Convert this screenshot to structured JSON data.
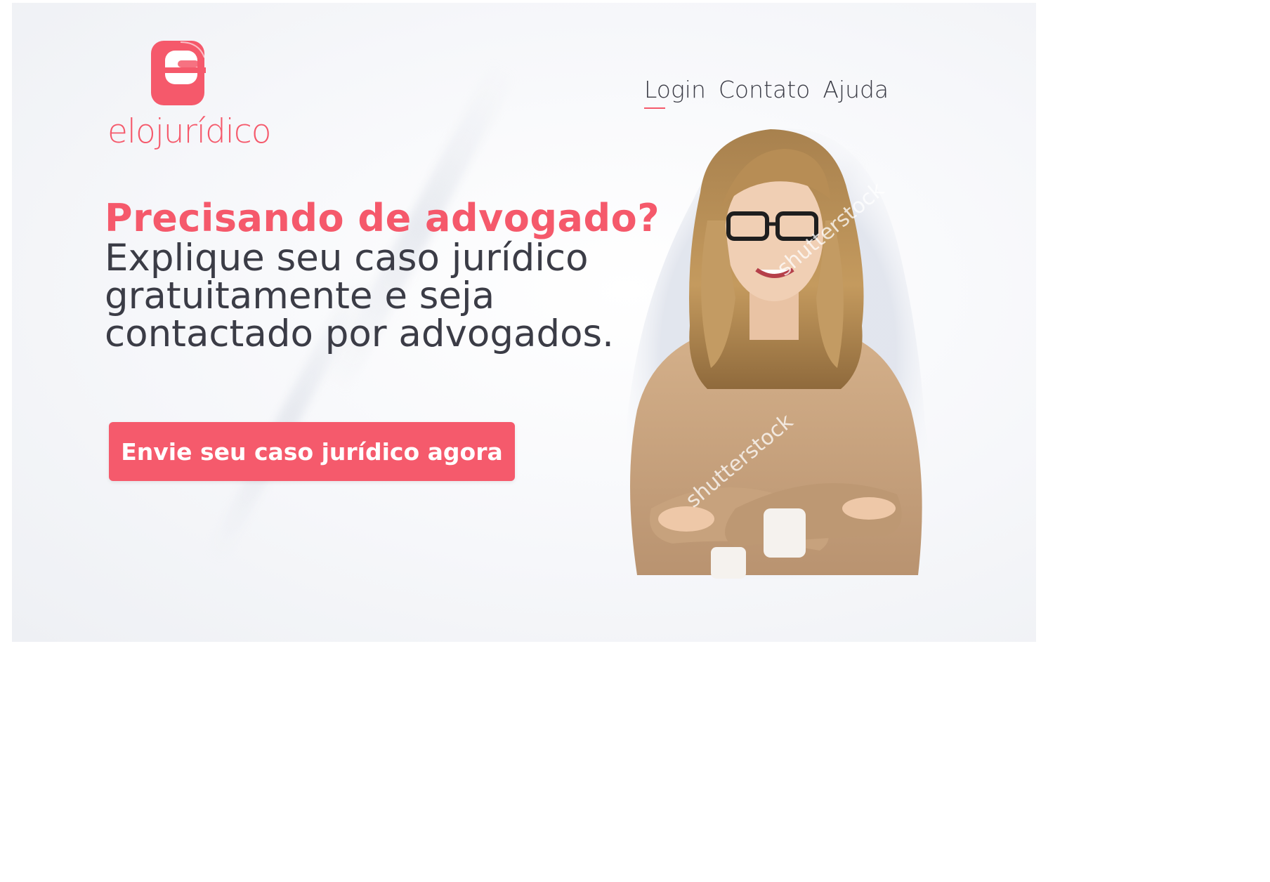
{
  "brand": {
    "name": "elojurídico",
    "color": "#f5596b"
  },
  "nav": {
    "items": [
      {
        "label": "Login",
        "active": true
      },
      {
        "label": "Contato",
        "active": false
      },
      {
        "label": "Ajuda",
        "active": false
      }
    ]
  },
  "hero": {
    "headline": "Precisando de advogado?",
    "subline_1": "Explique seu caso jurídico",
    "subline_2": "gratuitamente e seja",
    "subline_3": "contactado por advogados.",
    "cta_label": "Envie seu caso jurídico agora",
    "cta_color": "#f55a6c",
    "photo_watermark_1": "shutterstock",
    "photo_watermark_2": "shutterstock"
  }
}
